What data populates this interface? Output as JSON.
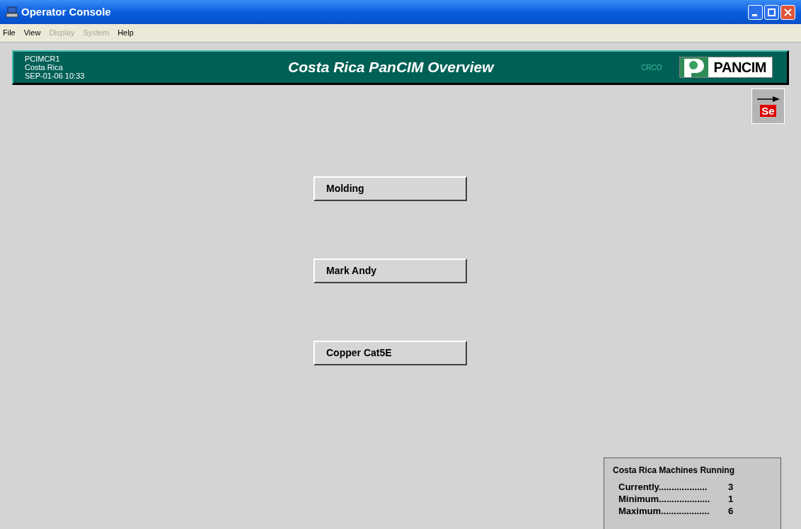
{
  "window": {
    "title": "Operator Console"
  },
  "menu": [
    {
      "label": "File",
      "disabled": false
    },
    {
      "label": "View",
      "disabled": false
    },
    {
      "label": "Display",
      "disabled": true
    },
    {
      "label": "System",
      "disabled": true
    },
    {
      "label": "Help",
      "disabled": false
    }
  ],
  "header": {
    "node": "PCIMCR1",
    "site": "Costa Rica",
    "datetime": "SEP-01-06 10:33",
    "title": "Costa Rica PanCIM Overview",
    "code": "CRCO",
    "logo": "PANCIM"
  },
  "nav_button": {
    "label": "Se"
  },
  "areas": [
    {
      "label": "Molding"
    },
    {
      "label": "Mark Andy"
    },
    {
      "label": "Copper Cat5E"
    }
  ],
  "machines": {
    "title": "Costa Rica Machines Running",
    "rows": [
      {
        "label": "Currently...................",
        "value": "3"
      },
      {
        "label": "Minimum....................",
        "value": "1"
      },
      {
        "label": "Maximum...................",
        "value": "6"
      }
    ]
  }
}
